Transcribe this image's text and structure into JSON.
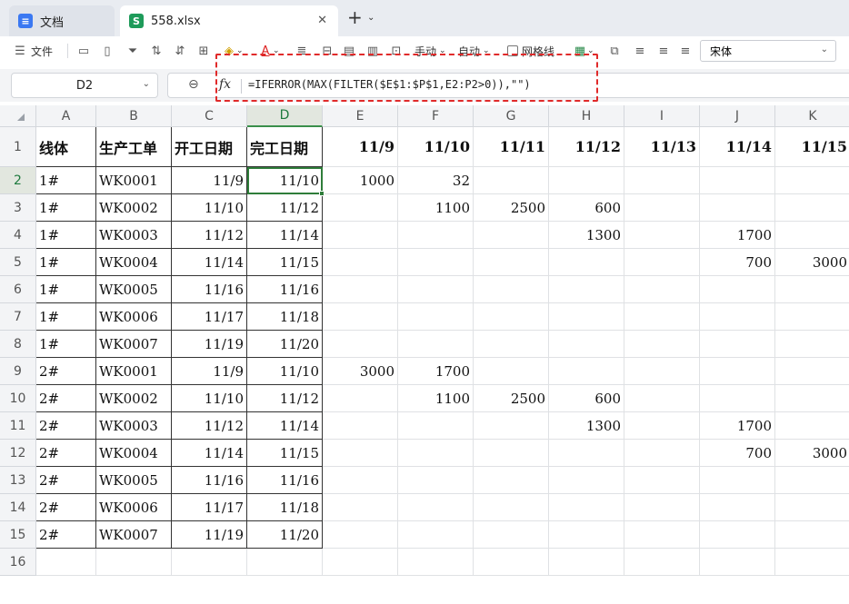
{
  "tabs": {
    "docs_label": "文档",
    "file_label": "558.xlsx",
    "docs_icon": "docs-icon",
    "file_icon": "sheet-icon",
    "close_glyph": "✕",
    "add_glyph": "+",
    "add_arrow": "⌄"
  },
  "toolbar": {
    "file_label": "文件",
    "manual_label": "手动",
    "auto_label": "自动",
    "gridlines_label": "网格线",
    "font_name": "宋体"
  },
  "formula_bar": {
    "cell_ref": "D2",
    "fx": "fx",
    "formula": "=IFERROR(MAX(FILTER($E$1:$P$1,E2:P2>0)),\"\")"
  },
  "sheet": {
    "columns": [
      "A",
      "B",
      "C",
      "D",
      "E",
      "F",
      "G",
      "H",
      "I",
      "J",
      "K"
    ],
    "active_column": "D",
    "active_row": 2,
    "rows": [
      [
        "线体",
        "生产工单",
        "开工日期",
        "完工日期",
        "11/9",
        "11/10",
        "11/11",
        "11/12",
        "11/13",
        "11/14",
        "11/15"
      ],
      [
        "1#",
        "WK0001",
        "11/9",
        "11/10",
        "1000",
        "32",
        "",
        "",
        "",
        "",
        ""
      ],
      [
        "1#",
        "WK0002",
        "11/10",
        "11/12",
        "",
        "1100",
        "2500",
        "600",
        "",
        "",
        ""
      ],
      [
        "1#",
        "WK0003",
        "11/12",
        "11/14",
        "",
        "",
        "",
        "1300",
        "",
        "1700",
        ""
      ],
      [
        "1#",
        "WK0004",
        "11/14",
        "11/15",
        "",
        "",
        "",
        "",
        "",
        "700",
        "3000"
      ],
      [
        "1#",
        "WK0005",
        "11/16",
        "11/16",
        "",
        "",
        "",
        "",
        "",
        "",
        ""
      ],
      [
        "1#",
        "WK0006",
        "11/17",
        "11/18",
        "",
        "",
        "",
        "",
        "",
        "",
        ""
      ],
      [
        "1#",
        "WK0007",
        "11/19",
        "11/20",
        "",
        "",
        "",
        "",
        "",
        "",
        ""
      ],
      [
        "2#",
        "WK0001",
        "11/9",
        "11/10",
        "3000",
        "1700",
        "",
        "",
        "",
        "",
        ""
      ],
      [
        "2#",
        "WK0002",
        "11/10",
        "11/12",
        "",
        "1100",
        "2500",
        "600",
        "",
        "",
        ""
      ],
      [
        "2#",
        "WK0003",
        "11/12",
        "11/14",
        "",
        "",
        "",
        "1300",
        "",
        "1700",
        ""
      ],
      [
        "2#",
        "WK0004",
        "11/14",
        "11/15",
        "",
        "",
        "",
        "",
        "",
        "700",
        "3000"
      ],
      [
        "2#",
        "WK0005",
        "11/16",
        "11/16",
        "",
        "",
        "",
        "",
        "",
        "",
        ""
      ],
      [
        "2#",
        "WK0006",
        "11/17",
        "11/18",
        "",
        "",
        "",
        "",
        "",
        "",
        ""
      ],
      [
        "2#",
        "WK0007",
        "11/19",
        "11/20",
        "",
        "",
        "",
        "",
        "",
        "",
        ""
      ],
      [
        "",
        "",
        "",
        "",
        "",
        "",
        "",
        "",
        "",
        "",
        ""
      ]
    ],
    "row_numbers": [
      "1",
      "2",
      "3",
      "4",
      "5",
      "6",
      "7",
      "8",
      "9",
      "10",
      "11",
      "12",
      "13",
      "14",
      "15",
      "16"
    ]
  },
  "colors": {
    "selection": "#2f7d3a",
    "highlight_border": "#e02a2a"
  }
}
